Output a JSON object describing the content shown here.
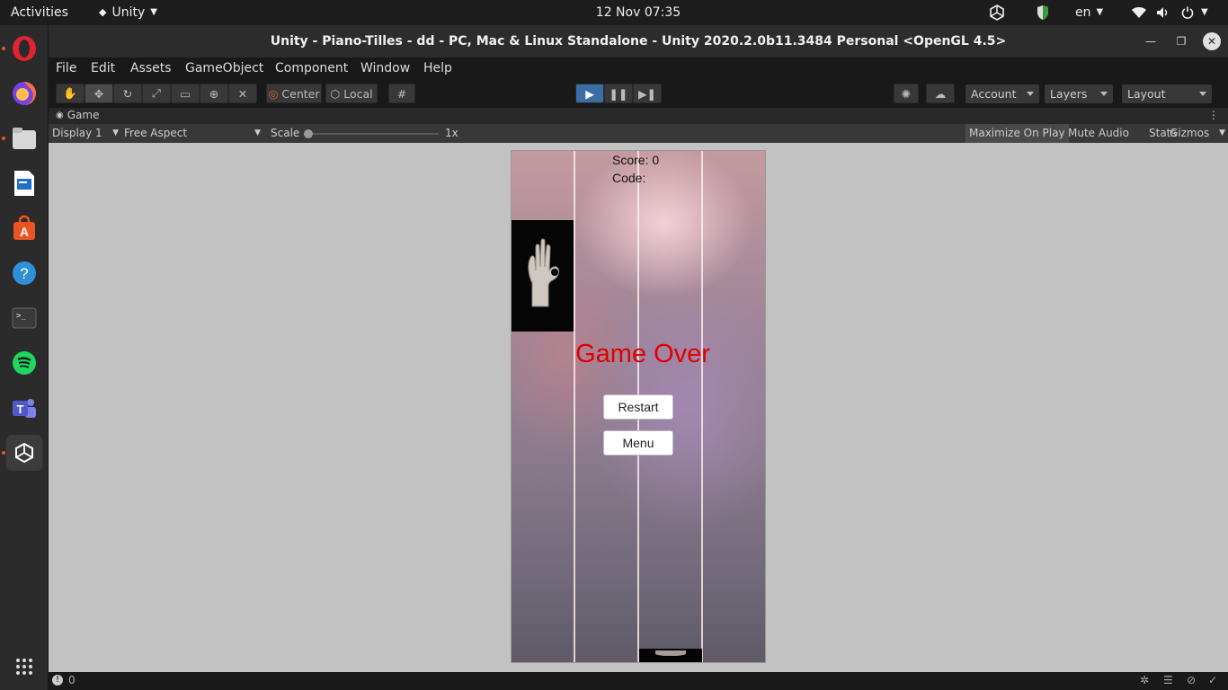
{
  "system": {
    "activities": "Activities",
    "app_menu": "Unity",
    "clock": "12 Nov  07:35",
    "language": "en"
  },
  "dock": {
    "items": [
      "opera-icon",
      "firefox-icon",
      "files-icon",
      "writer-icon",
      "software-icon",
      "help-icon",
      "terminal-icon",
      "spotify-icon",
      "teams-icon",
      "unity-icon",
      "app-grid-icon"
    ]
  },
  "window": {
    "title": "Unity - Piano-Tilles - dd - PC, Mac & Linux Standalone - Unity 2020.2.0b11.3484 Personal <OpenGL 4.5>"
  },
  "menu": {
    "items": [
      "File",
      "Edit",
      "Assets",
      "GameObject",
      "Component",
      "Window",
      "Help"
    ]
  },
  "toolbar": {
    "pivot": "Center",
    "space": "Local",
    "account": "Account",
    "layers": "Layers",
    "layout": "Layout"
  },
  "game_tab": {
    "label": "Game",
    "display": "Display 1",
    "aspect": "Free Aspect",
    "scale_label": "Scale",
    "scale_value": "1x",
    "maximize": "Maximize On Play",
    "mute": "Mute Audio",
    "stats": "Stats",
    "gizmos": "Gizmos"
  },
  "game": {
    "score": "Score: 0",
    "code": "Code:",
    "game_over": "Game Over",
    "restart": "Restart",
    "menu": "Menu"
  },
  "status": {
    "count": "0"
  },
  "colors": {
    "accent_play": "#3b6ea5",
    "game_over": "#e00000"
  }
}
